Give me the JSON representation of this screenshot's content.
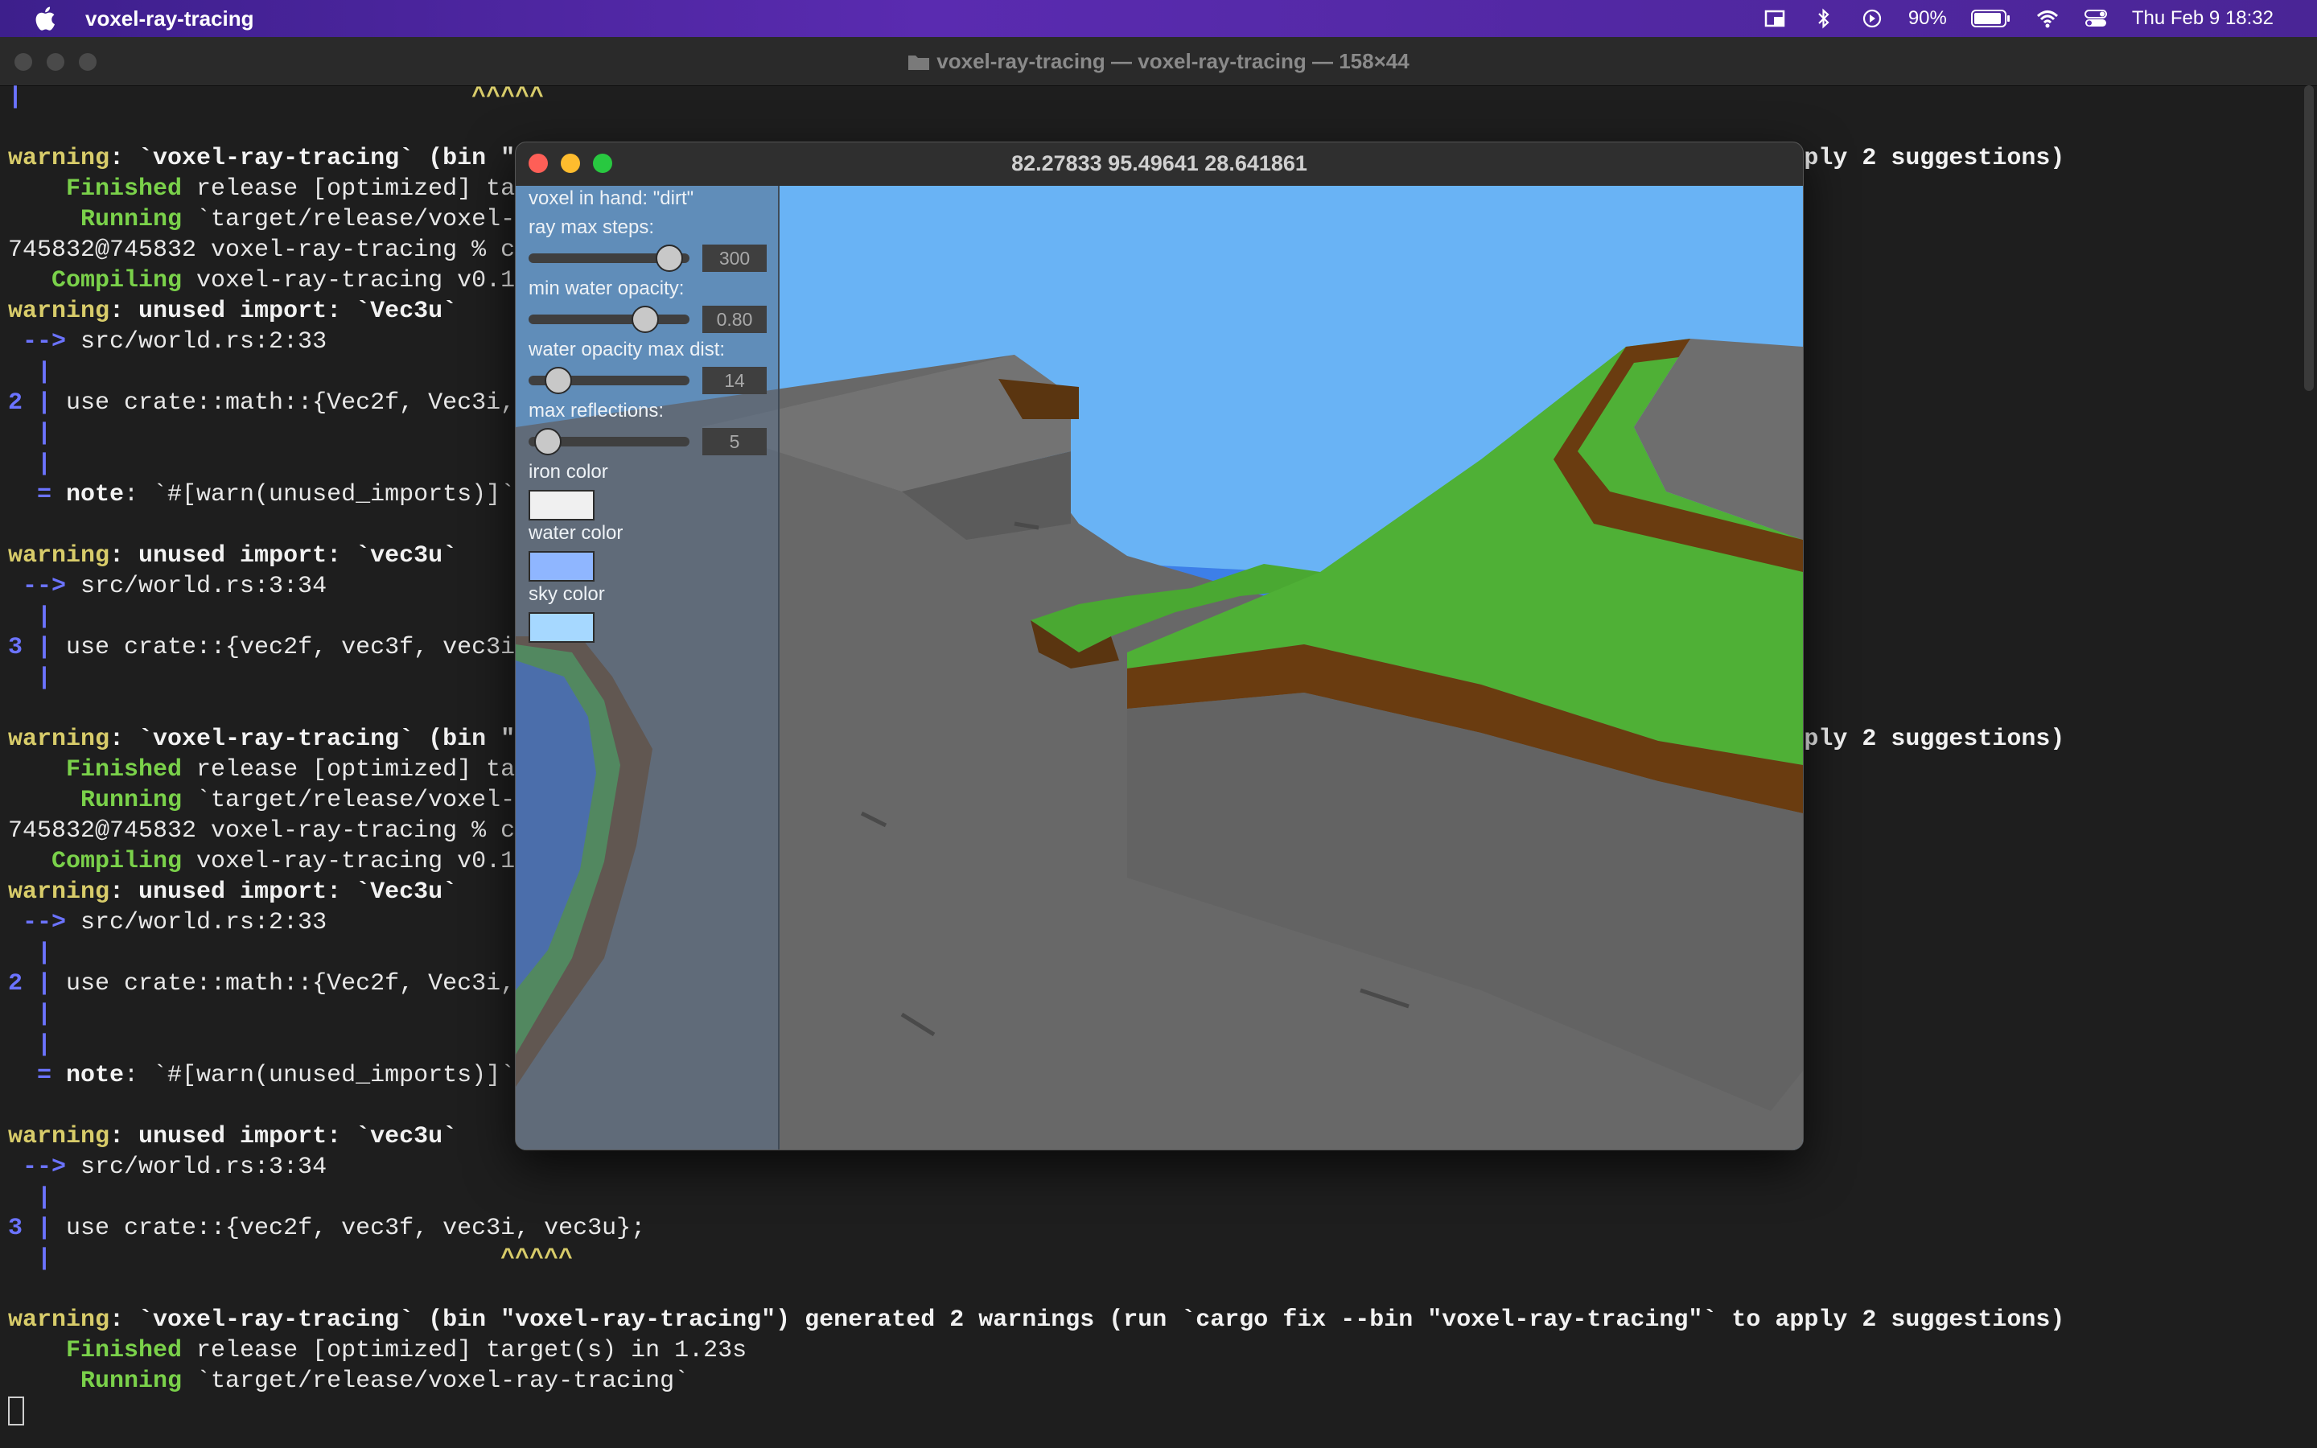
{
  "menubar": {
    "app_name": "voxel-ray-tracing",
    "battery": "90%",
    "datetime": "Thu Feb 9  18:32"
  },
  "terminal": {
    "title": "voxel-ray-tracing — voxel-ray-tracing — 158×44",
    "lines": [
      {
        "y": 0,
        "parts": [
          {
            "c": "b",
            "t": "|"
          },
          {
            "t": "                               "
          },
          {
            "c": "y",
            "t": "^^^^^"
          }
        ]
      },
      {
        "y": 2,
        "parts": [
          {
            "c": "y",
            "t": "warning"
          },
          {
            "c": "w",
            "t": ": `voxel-ray-tracing` (bin \"voxel-ray-tracing\") generated 2 warnings (run `cargo fix --bin \"voxel-ray-tracing\"` to apply 2 suggestions)"
          }
        ]
      },
      {
        "y": 3,
        "parts": [
          {
            "c": "g",
            "t": "    Finished"
          },
          {
            "t": " release [optimized] target(s) in 1.23s"
          }
        ]
      },
      {
        "y": 4,
        "parts": [
          {
            "c": "g",
            "t": "     Running"
          },
          {
            "t": " `target/release/voxel-ray-tracing`"
          }
        ]
      },
      {
        "y": 5,
        "parts": [
          {
            "t": "745832@745832 voxel-ray-tracing % cargo run --release"
          }
        ]
      },
      {
        "y": 6,
        "parts": [
          {
            "c": "g",
            "t": "   Compiling"
          },
          {
            "t": " voxel-ray-tracing v0.1.0"
          }
        ]
      },
      {
        "y": 7,
        "parts": [
          {
            "c": "y",
            "t": "warning"
          },
          {
            "c": "w",
            "t": ": unused import: `Vec3u`"
          }
        ]
      },
      {
        "y": 8,
        "parts": [
          {
            "c": "b",
            "t": " --> "
          },
          {
            "t": "src/world.rs:2:33"
          }
        ]
      },
      {
        "y": 9,
        "parts": [
          {
            "c": "b",
            "t": "  |"
          }
        ]
      },
      {
        "y": 10,
        "parts": [
          {
            "c": "b",
            "t": "2 |"
          },
          {
            "t": " use crate::math::{Vec2f, Vec3i, Vec3u};"
          }
        ]
      },
      {
        "y": 11,
        "parts": [
          {
            "c": "b",
            "t": "  |"
          }
        ]
      },
      {
        "y": 12,
        "parts": [
          {
            "c": "b",
            "t": "  |"
          }
        ]
      },
      {
        "y": 13,
        "parts": [
          {
            "c": "b",
            "t": "  = "
          },
          {
            "c": "w",
            "t": "note"
          },
          {
            "t": ": `#[warn(unused_imports)]` on by default"
          }
        ]
      },
      {
        "y": 15,
        "parts": [
          {
            "c": "y",
            "t": "warning"
          },
          {
            "c": "w",
            "t": ": unused import: `vec3u`"
          }
        ]
      },
      {
        "y": 16,
        "parts": [
          {
            "c": "b",
            "t": " --> "
          },
          {
            "t": "src/world.rs:3:34"
          }
        ]
      },
      {
        "y": 17,
        "parts": [
          {
            "c": "b",
            "t": "  |"
          }
        ]
      },
      {
        "y": 18,
        "parts": [
          {
            "c": "b",
            "t": "3 |"
          },
          {
            "t": " use crate::{vec2f, vec3f, vec3i, vec3u};"
          }
        ]
      },
      {
        "y": 19,
        "parts": [
          {
            "c": "b",
            "t": "  |"
          }
        ]
      },
      {
        "y": 21,
        "parts": [
          {
            "c": "y",
            "t": "warning"
          },
          {
            "c": "w",
            "t": ": `voxel-ray-tracing` (bin \"voxel-ray-tracing\") generated 2 warnings (run `cargo fix --bin \"voxel-ray-tracing\"` to apply 2 suggestions)"
          }
        ]
      },
      {
        "y": 22,
        "parts": [
          {
            "c": "g",
            "t": "    Finished"
          },
          {
            "t": " release [optimized] target(s) in 1.23s"
          }
        ]
      },
      {
        "y": 23,
        "parts": [
          {
            "c": "g",
            "t": "     Running"
          },
          {
            "t": " `target/release/voxel-ray-tracing`"
          }
        ]
      },
      {
        "y": 24,
        "parts": [
          {
            "t": "745832@745832 voxel-ray-tracing % cargo run --release"
          }
        ]
      },
      {
        "y": 25,
        "parts": [
          {
            "c": "g",
            "t": "   Compiling"
          },
          {
            "t": " voxel-ray-tracing v0.1.0"
          }
        ]
      },
      {
        "y": 26,
        "parts": [
          {
            "c": "y",
            "t": "warning"
          },
          {
            "c": "w",
            "t": ": unused import: `Vec3u`"
          }
        ]
      },
      {
        "y": 27,
        "parts": [
          {
            "c": "b",
            "t": " --> "
          },
          {
            "t": "src/world.rs:2:33"
          }
        ]
      },
      {
        "y": 28,
        "parts": [
          {
            "c": "b",
            "t": "  |"
          }
        ]
      },
      {
        "y": 29,
        "parts": [
          {
            "c": "b",
            "t": "2 |"
          },
          {
            "t": " use crate::math::{Vec2f, Vec3i, Vec3u};"
          }
        ]
      },
      {
        "y": 30,
        "parts": [
          {
            "c": "b",
            "t": "  |"
          }
        ]
      },
      {
        "y": 31,
        "parts": [
          {
            "c": "b",
            "t": "  |"
          }
        ]
      },
      {
        "y": 32,
        "parts": [
          {
            "c": "b",
            "t": "  = "
          },
          {
            "c": "w",
            "t": "note"
          },
          {
            "t": ": `#[warn(unused_imports)]` on by default"
          }
        ]
      },
      {
        "y": 34,
        "parts": [
          {
            "c": "y",
            "t": "warning"
          },
          {
            "c": "w",
            "t": ": unused import: `vec3u`"
          }
        ]
      },
      {
        "y": 35,
        "parts": [
          {
            "c": "b",
            "t": " --> "
          },
          {
            "t": "src/world.rs:3:34"
          }
        ]
      },
      {
        "y": 36,
        "parts": [
          {
            "c": "b",
            "t": "  |"
          }
        ]
      },
      {
        "y": 37,
        "parts": [
          {
            "c": "b",
            "t": "3 |"
          },
          {
            "t": " use crate::{vec2f, vec3f, vec3i, vec3u};"
          }
        ]
      },
      {
        "y": 38,
        "parts": [
          {
            "c": "b",
            "t": "  |"
          },
          {
            "t": "                               "
          },
          {
            "c": "y",
            "t": "^^^^^"
          }
        ]
      },
      {
        "y": 40,
        "parts": [
          {
            "c": "y",
            "t": "warning"
          },
          {
            "c": "w",
            "t": ": `voxel-ray-tracing` (bin \"voxel-ray-tracing\") generated 2 warnings (run `cargo fix --bin \"voxel-ray-tracing\"` to apply 2 suggestions)"
          }
        ]
      },
      {
        "y": 41,
        "parts": [
          {
            "c": "g",
            "t": "    Finished"
          },
          {
            "t": " release [optimized] target(s) in 1.23s"
          }
        ]
      },
      {
        "y": 42,
        "parts": [
          {
            "c": "g",
            "t": "     Running"
          },
          {
            "t": " `target/release/voxel-ray-tracing`"
          }
        ]
      }
    ]
  },
  "app": {
    "title": "82.27833 95.49641 28.641861",
    "panel": {
      "voxel_in_hand": "voxel in hand: \"dirt\"",
      "ray_max_steps_label": "ray max steps:",
      "ray_max_steps_value": "300",
      "ray_max_steps_fraction": 0.93,
      "min_water_opacity_label": "min water opacity:",
      "min_water_opacity_value": "0.80",
      "min_water_opacity_fraction": 0.75,
      "water_opacity_max_dist_label": "water opacity max dist:",
      "water_opacity_max_dist_value": "14",
      "water_opacity_max_dist_fraction": 0.12,
      "max_reflections_label": "max reflections:",
      "max_reflections_value": "5",
      "max_reflections_fraction": 0.04,
      "iron_color_label": "iron color",
      "iron_color": "#f0f0f0",
      "water_color_label": "water color",
      "water_color": "#8fb6ff",
      "sky_color_label": "sky color",
      "sky_color": "#a6d8ff"
    }
  }
}
